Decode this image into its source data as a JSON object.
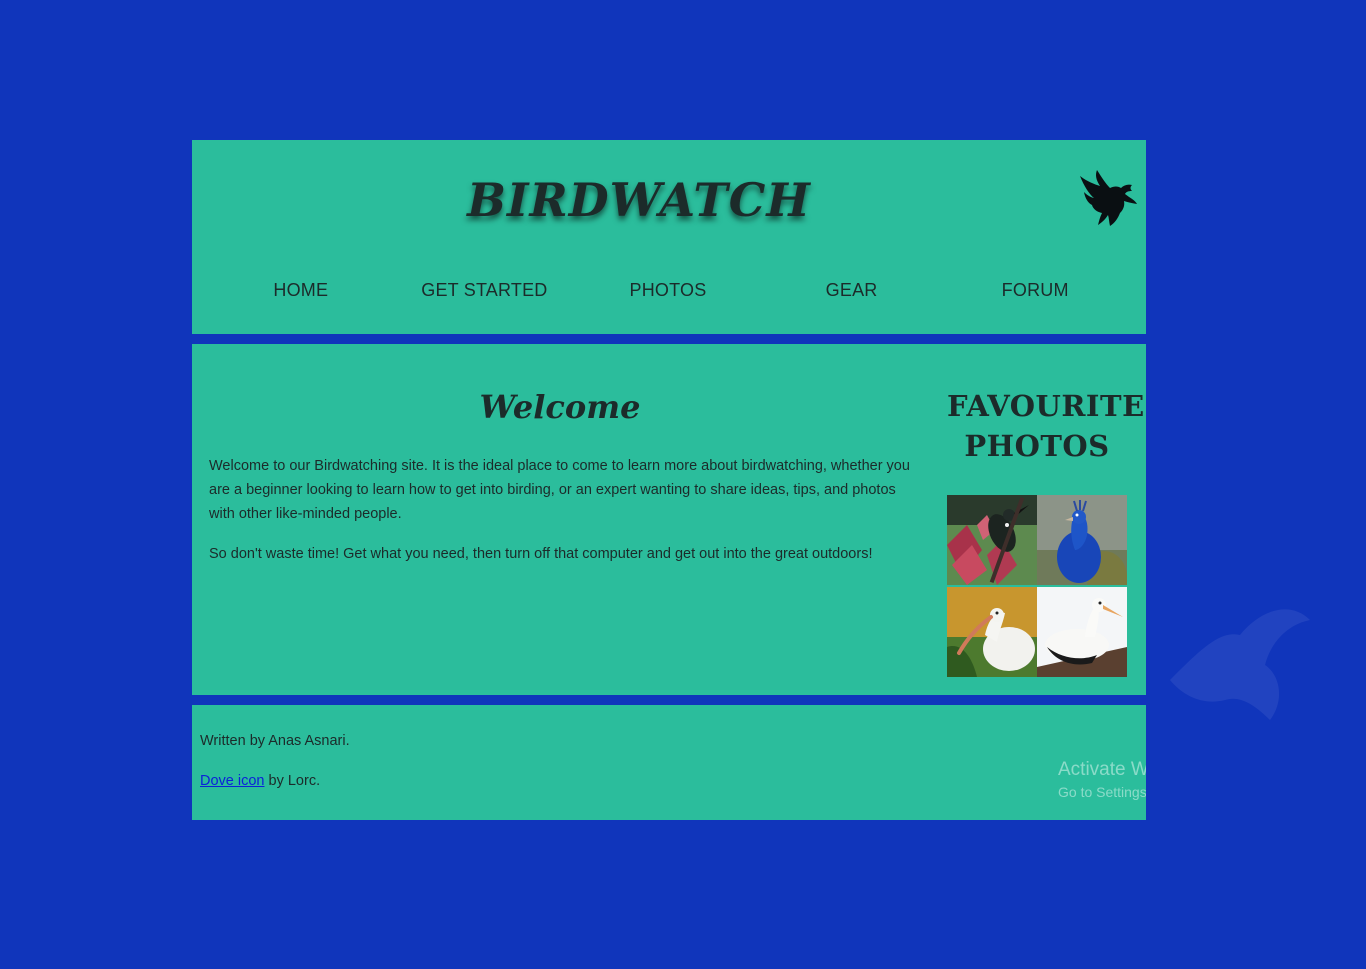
{
  "header": {
    "site_title": "BIRDWATCH",
    "logo_icon": "dove-icon"
  },
  "nav": {
    "items": [
      {
        "label": "HOME"
      },
      {
        "label": "GET STARTED"
      },
      {
        "label": "PHOTOS"
      },
      {
        "label": "GEAR"
      },
      {
        "label": "FORUM"
      }
    ]
  },
  "main": {
    "welcome": {
      "title": "Welcome",
      "paragraphs": [
        "Welcome to our Birdwatching site. It is the ideal place to come to learn more about birdwatching, whether you are a beginner looking to learn how to get into birding, or an expert wanting to share ideas, tips, and photos with other like-minded people.",
        "So don't waste time! Get what you need, then turn off that computer and get out into the great outdoors!"
      ]
    },
    "favourites": {
      "title_line1": "FAVOURITE",
      "title_line2": "PHOTOS",
      "photos": [
        "tui-photo",
        "peacock-photo",
        "ibis-photo",
        "stork-photo"
      ]
    }
  },
  "footer": {
    "credit": "Written by Anas Asnari.",
    "icon_link": "Dove icon",
    "icon_credit": "by Lorc."
  },
  "watermark": {
    "title": "Activate Windows",
    "subtitle": "Go to Settings to activate Windows."
  },
  "colors": {
    "page_background": "#1035bb",
    "panel": "#2bbd9c",
    "text": "#1c2b2a",
    "link": "#0b22d8"
  }
}
